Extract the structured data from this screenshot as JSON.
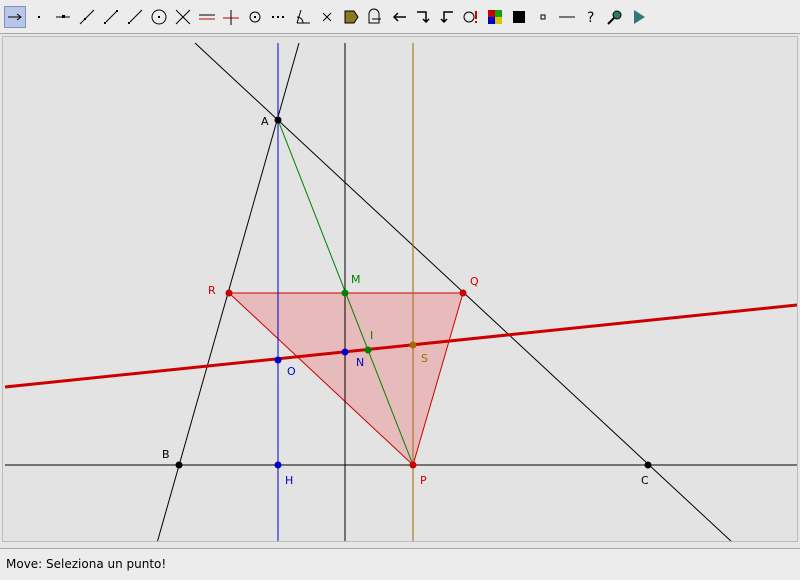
{
  "toolbar": {
    "tools": [
      {
        "name": "move-tool-icon",
        "active": true
      },
      {
        "name": "point-tool-icon"
      },
      {
        "name": "segment-point-tool-icon"
      },
      {
        "name": "line-tool-icon"
      },
      {
        "name": "segment-tool-icon"
      },
      {
        "name": "ray-tool-icon"
      },
      {
        "name": "circle-tool-icon"
      },
      {
        "name": "intersect-tool-icon"
      },
      {
        "name": "parallel-line-tool-icon"
      },
      {
        "name": "perpendicular-line-tool-icon"
      },
      {
        "name": "midpoint-tool-icon"
      },
      {
        "name": "locus-tool-icon"
      },
      {
        "name": "angle-tool-icon"
      },
      {
        "name": "delete-tool-icon"
      },
      {
        "name": "polygon-tool-icon"
      },
      {
        "name": "measure-tool-icon"
      },
      {
        "name": "undo-arrow-icon"
      },
      {
        "name": "redo-step-icon"
      },
      {
        "name": "back-step-icon"
      },
      {
        "name": "relation-tool-icon"
      },
      {
        "name": "color-palette-icon"
      },
      {
        "name": "fill-black-icon"
      },
      {
        "name": "small-point-icon"
      },
      {
        "name": "line-style-icon"
      },
      {
        "name": "help-icon"
      },
      {
        "name": "zoom-tool-icon"
      },
      {
        "name": "play-icon"
      }
    ]
  },
  "colors": {
    "black": "#000000",
    "blue": "#0000cc",
    "green": "#008000",
    "red": "#cc0000",
    "brown": "#a06a00",
    "triangle_fill": "#e8a8a8"
  },
  "points": {
    "A": "A",
    "B": "B",
    "C": "C",
    "H": "H",
    "O": "O",
    "M": "M",
    "N": "N",
    "I": "I",
    "S": "S",
    "Q": "Q",
    "R": "R",
    "P": "P"
  },
  "status": {
    "text": "Move: Seleziona un punto!"
  }
}
